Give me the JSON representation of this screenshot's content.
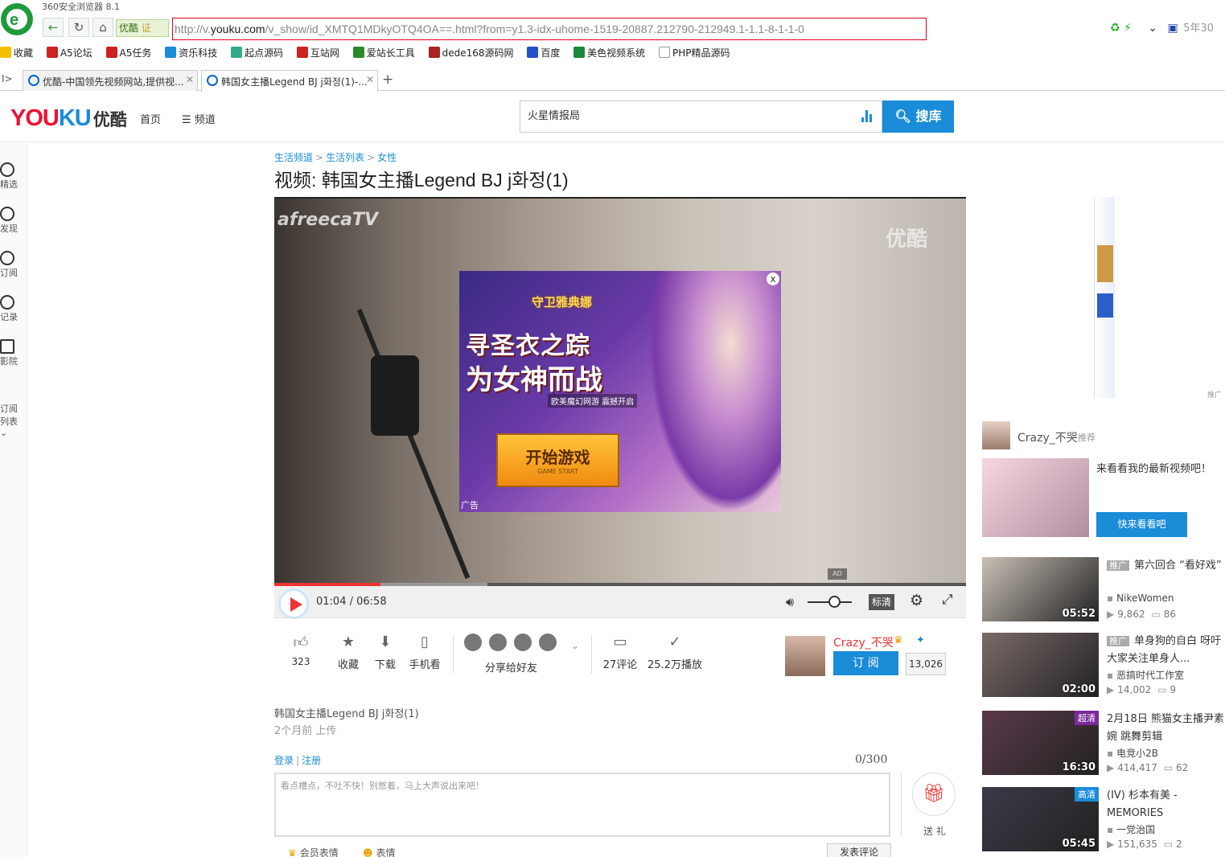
{
  "browser": {
    "title": "360安全浏览器 8.1",
    "site_badge": "优酷",
    "site_badge_cert": "证",
    "url_prefix": "http://v.",
    "url_domain": "youku.com",
    "url_path": "/v_show/id_XMTQ1MDkyOTQ4OA==.html?from=y1.3-idx-uhome-1519-20887.212790-212949.1-1.1-8-1-1-0",
    "right_text": "5年30",
    "bookmarks": [
      "收藏",
      "A5论坛",
      "A5任务",
      "资乐科技",
      "起点源码",
      "互站网",
      "爱站长工具",
      "dede168源码网",
      "百度",
      "美色视频系统",
      "PHP精品源码"
    ],
    "tabs": [
      {
        "label": "优酷-中国领先视频网站,提供视..."
      },
      {
        "label": "韩国女主播Legend BJ j화정(1)-..."
      }
    ]
  },
  "header": {
    "logo_main": "YOUKU",
    "logo_cn": "优酷",
    "nav_home": "首页",
    "nav_channels": "频道",
    "search_value": "火星情报局",
    "search_button": "搜库"
  },
  "left_rail": [
    "精选",
    "发现",
    "订阅",
    "记录",
    "影院",
    "订阅列表"
  ],
  "breadcrumb": [
    "生活频道",
    "生活列表",
    "女性"
  ],
  "page_title": "视频: 韩国女主播Legend BJ j화정(1)",
  "player": {
    "watermark_left": "afreecaTV",
    "watermark_right": "优酷",
    "current_time": "01:04",
    "total_time": "06:58",
    "quality": "标清",
    "progress": 0.153,
    "buffered": 0.308,
    "volume": 0.6
  },
  "ad": {
    "game_logo": "守卫雅典娜",
    "headline1": "寻圣衣之踪",
    "headline2": "为女神而战",
    "subtitle": "欧美魔幻网游 震撼开启",
    "start_label": "开始游戏",
    "start_sub": "GAME START",
    "ad_label": "广告",
    "close": "x"
  },
  "actions": {
    "like_count": "323",
    "favorite": "收藏",
    "download": "下载",
    "mobile": "手机看",
    "share": "分享给好友",
    "comments": "27评论",
    "plays": "25.2万播放"
  },
  "uploader": {
    "name": "Crazy_不哭",
    "subscribe": "订 阅",
    "subscribers": "13,026"
  },
  "description": {
    "title": "韩国女主播Legend BJ j화정(1)",
    "uploaded": "2个月前 上传"
  },
  "comment": {
    "login": "登录",
    "register": "注册",
    "count": "0/300",
    "placeholder": "看点槽点，不吐不快！别憋着，马上大声说出来吧！",
    "gift": "送 礼",
    "emoji_vip": "会员表情",
    "emoji": "表情",
    "post": "发表评论"
  },
  "right": {
    "banner_tag": "推广",
    "recommend_name": "Crazy_不哭",
    "recommend_tag": "推荐",
    "recommend_text": "来看看我的最新视频吧！",
    "recommend_button": "快来看看吧",
    "videos": [
      {
        "promo": "推广",
        "title": "第六回合 “看好戏”",
        "owner": "NikeWomen",
        "plays": "9,862",
        "comments": "86",
        "duration": "05:52",
        "flag": "",
        "thumb_color": "#c9c0b6"
      },
      {
        "promo": "推广",
        "title": "单身狗的自白 呀吁大家关注单身人...",
        "owner": "恶搞时代工作室",
        "plays": "14,002",
        "comments": "9",
        "duration": "02:00",
        "flag": "",
        "thumb_color": "#7a6a68"
      },
      {
        "promo": "",
        "title": "2月18日 熊猫女主播尹素婉 跳舞剪辑",
        "owner": "电竞小2B",
        "plays": "414,417",
        "comments": "62",
        "duration": "16:30",
        "flag": "超清",
        "flag_color": "#7a2a9a",
        "thumb_color": "#5a3a4a"
      },
      {
        "promo": "",
        "title": "(IV) 杉本有美 - MEMORIES",
        "owner": "一党治国",
        "plays": "151,635",
        "comments": "2",
        "duration": "05:45",
        "flag": "高清",
        "flag_color": "#1a8cd8",
        "thumb_color": "#3a3a48"
      }
    ]
  }
}
